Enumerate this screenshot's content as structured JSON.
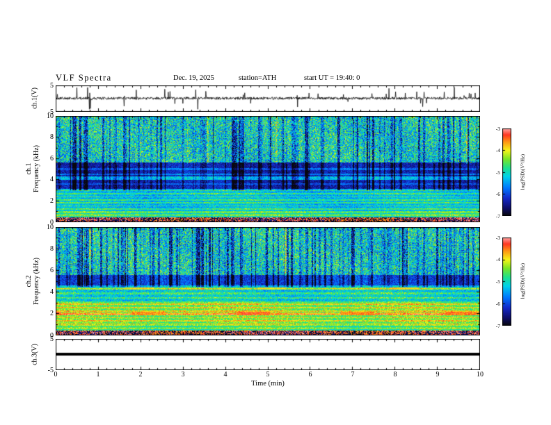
{
  "header": {
    "title": "VLF Spectra",
    "date": "Dec. 19, 2025",
    "station": "station=ATH",
    "start_ut": "start UT =  19:40: 0"
  },
  "axes": {
    "time_label": "Time (min)",
    "time_ticks": [
      0,
      1,
      2,
      3,
      4,
      5,
      6,
      7,
      8,
      9,
      10
    ],
    "freq_label": "Frequency (kHz)",
    "freq_ticks": [
      0,
      2,
      4,
      6,
      8,
      10
    ],
    "volt_ticks": [
      5,
      -5
    ],
    "colorbar_label": "log(PSD)(V²/Hz)",
    "colorbar_ticks": [
      -3,
      -4,
      -5,
      -6,
      -7
    ]
  },
  "panels": {
    "ch1_wave_label": "ch.1(V)",
    "ch1_spec_channel": "ch.1",
    "ch2_spec_channel": "ch.2",
    "ch3_wave_label": "ch.3(V)"
  },
  "colors": {
    "background": "#ffffff",
    "axis": "#000000",
    "trace": "#000000",
    "colormap_stops": [
      [
        0.0,
        [
          8,
          8,
          14
        ]
      ],
      [
        0.08,
        [
          14,
          14,
          100
        ]
      ],
      [
        0.2,
        [
          20,
          40,
          200
        ]
      ],
      [
        0.32,
        [
          0,
          120,
          255
        ]
      ],
      [
        0.45,
        [
          0,
          210,
          235
        ]
      ],
      [
        0.55,
        [
          30,
          225,
          140
        ]
      ],
      [
        0.65,
        [
          120,
          230,
          40
        ]
      ],
      [
        0.75,
        [
          245,
          245,
          25
        ]
      ],
      [
        0.85,
        [
          255,
          150,
          20
        ]
      ],
      [
        0.93,
        [
          255,
          55,
          35
        ]
      ],
      [
        1.0,
        [
          255,
          165,
          165
        ]
      ]
    ]
  },
  "chart_data": [
    {
      "type": "line",
      "panel": "ch1_waveform",
      "ylabel": "ch.1(V)",
      "xlabel": "Time (min)",
      "xlim": [
        0,
        10
      ],
      "ylim": [
        -5,
        5
      ],
      "ytick_labels": [
        5,
        -5
      ],
      "description": "Broadband noise fluctuating around 0 V (about ±1 V) with frequent impulsive spikes reaching roughly ±4 V across the full 10 minutes",
      "gen": {
        "seed": 1101,
        "n": 1220,
        "noise_amp": 0.5,
        "spike_prob": 0.04,
        "spike_amp": 2.6,
        "big_spike_prob": 0.01,
        "big_spike_amp": 4.3
      }
    },
    {
      "type": "heatmap",
      "panel": "ch1_spectrogram",
      "ylabel_line1": "ch.1",
      "ylabel_line2": "Frequency (kHz)",
      "xlabel": "Time (min)",
      "xlim": [
        0,
        10
      ],
      "ylim": [
        0,
        10
      ],
      "yticks": [
        0,
        2,
        4,
        6,
        8,
        10
      ],
      "value_label": "log(PSD)(V²/Hz)",
      "vrange": [
        -7,
        -3
      ],
      "features": [
        "intense red/black band below ~0.4 kHz",
        "bright cyan-green horizontal banding 0.4-3 kHz",
        "dark blue quiet region 3-5.6 kHz with enhanced narrow lines near 3.6, 4.1, 4.5 and 5.0 kHz",
        "speckled cyan/green/yellow background 5.6-10 kHz",
        "dense dark-blue vertical striations (impulsive dropouts) above ~3 kHz over the whole record"
      ],
      "gen": {
        "seed": 2201,
        "bands": [
          {
            "f": [
              0,
              0.4
            ],
            "mode": "bimodal",
            "hi": -3.3,
            "lo": -6.8,
            "p": 0.5
          },
          {
            "f": [
              0.4,
              1.0
            ],
            "base": -4.7,
            "noise": 0.45,
            "ripple": 0.35
          },
          {
            "f": [
              1.0,
              3.1
            ],
            "base": -5.35,
            "noise": 0.4,
            "lines": {
              "spacing": 0.29,
              "boost": 0.85
            }
          },
          {
            "f": [
              3.1,
              5.6
            ],
            "base": -6.3,
            "noise": 0.35
          },
          {
            "f": [
              5.6,
              10
            ],
            "base": -5.05,
            "noise": 0.95
          }
        ],
        "hlines": [
          {
            "f": 3.6,
            "w": 0.07,
            "boost": 0.55
          },
          {
            "f": 4.12,
            "w": 0.16,
            "boost": 1.25
          },
          {
            "f": 4.5,
            "w": 0.09,
            "boost": 0.8
          },
          {
            "f": 5.0,
            "w": 0.09,
            "boost": 0.65
          }
        ],
        "red_segments": [],
        "streaks": {
          "prob": 0.42,
          "fmin": 3.0,
          "max_darken": 1.9
        },
        "bright_cols": {
          "prob": 0.02,
          "fmin": 5.5,
          "boost": 0.55
        }
      }
    },
    {
      "type": "heatmap",
      "panel": "ch2_spectrogram",
      "ylabel_line1": "ch.2",
      "ylabel_line2": "Frequency (kHz)",
      "xlabel": "Time (min)",
      "xlim": [
        0,
        10
      ],
      "ylim": [
        0,
        10
      ],
      "yticks": [
        0,
        2,
        4,
        6,
        8,
        10
      ],
      "value_label": "log(PSD)(V²/Hz)",
      "vrange": [
        -7,
        -3
      ],
      "features": [
        "intense red/black band below ~0.4 kHz",
        "strong yellow/green horizontal banding 1-3 kHz",
        "intermittent dark-red dashed segments near 2.0 kHz and 4.3 kHz",
        "green mixed region 3-4.6 kHz, darker blue 4.6-5.6 kHz",
        "speckled cyan/green/yellow background 5.6-10 kHz with dense dark-blue vertical striations"
      ],
      "gen": {
        "seed": 3301,
        "bands": [
          {
            "f": [
              0,
              0.4
            ],
            "mode": "bimodal",
            "hi": -3.3,
            "lo": -6.8,
            "p": 0.5
          },
          {
            "f": [
              0.4,
              1.0
            ],
            "base": -4.55,
            "noise": 0.45,
            "ripple": 0.35
          },
          {
            "f": [
              1.0,
              3.05
            ],
            "base": -4.5,
            "noise": 0.45,
            "lines": {
              "spacing": 0.31,
              "boost": 0.8
            }
          },
          {
            "f": [
              3.05,
              4.6
            ],
            "base": -5.2,
            "noise": 0.5,
            "lines": {
              "spacing": 0.42,
              "boost": 0.7
            }
          },
          {
            "f": [
              4.6,
              5.6
            ],
            "base": -6.0,
            "noise": 0.4
          },
          {
            "f": [
              5.6,
              10
            ],
            "base": -5.05,
            "noise": 0.95
          }
        ],
        "hlines": [
          {
            "f": 2.0,
            "w": 0.1,
            "boost": 0.9
          },
          {
            "f": 4.3,
            "w": 0.1,
            "boost": 0.7
          }
        ],
        "red_segments": [
          {
            "f": [
              1.85,
              2.15
            ],
            "level": -3.5,
            "period": 150,
            "duty": 0.32,
            "phase": 40
          },
          {
            "f": [
              4.2,
              4.45
            ],
            "level": -3.9,
            "period": 190,
            "duty": 0.22,
            "phase": 90
          }
        ],
        "streaks": {
          "prob": 0.42,
          "fmin": 4.5,
          "max_darken": 1.9
        },
        "bright_cols": {
          "prob": 0.02,
          "fmin": 5.5,
          "boost": 0.55
        }
      }
    },
    {
      "type": "line",
      "panel": "ch3_waveform",
      "ylabel": "ch.3(V)",
      "xlabel": "Time (min)",
      "xlim": [
        0,
        10
      ],
      "ylim": [
        -5,
        5
      ],
      "ytick_labels": [
        5,
        -5
      ],
      "value": 0,
      "description": "Completely flat thick black trace at 0 V for the entire 10 minutes (channel inactive)"
    }
  ]
}
